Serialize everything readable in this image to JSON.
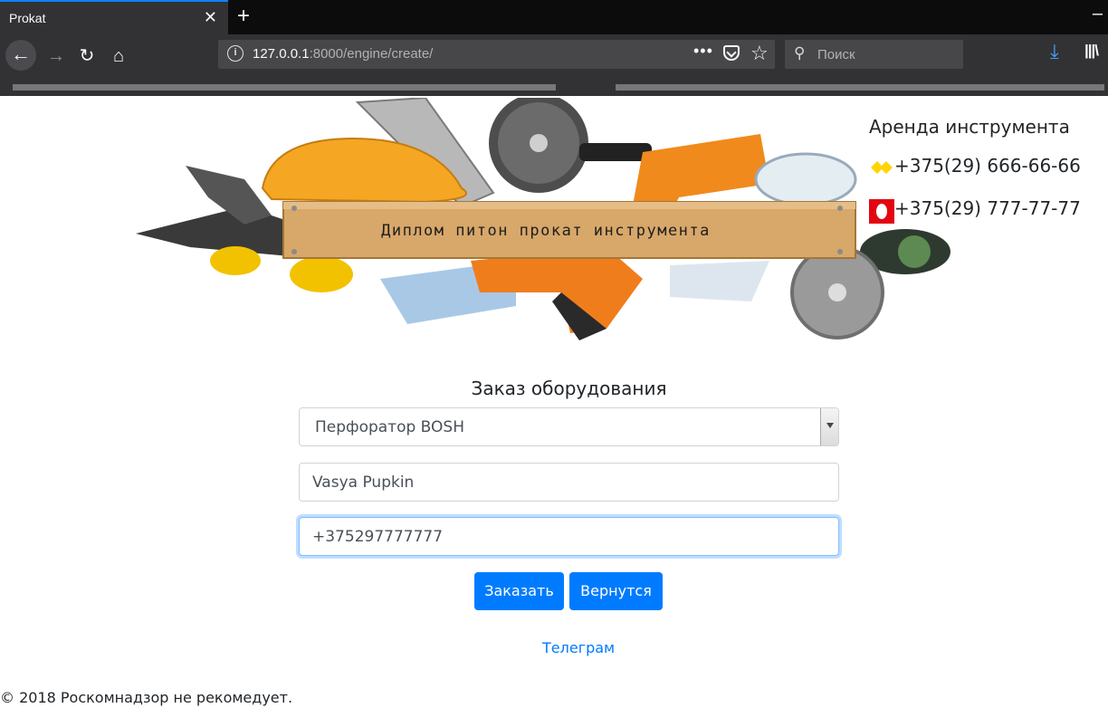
{
  "browser": {
    "tab_title": "Prokat",
    "tab_close": "✕",
    "new_tab": "+",
    "url_host": "127.0.0.1",
    "url_rest": ":8000/engine/create/",
    "search_placeholder": "Поиск",
    "icons": [
      "back-arrow-icon",
      "forward-arrow-icon",
      "reload-icon",
      "home-icon",
      "info-icon",
      "more-dots-icon",
      "pocket-icon",
      "star-icon",
      "search-icon",
      "download-icon",
      "library-icon"
    ]
  },
  "hero": {
    "plank_text": "Диплом питон прокат инструмента"
  },
  "contacts": {
    "title": "Аренда инструмента",
    "phones": [
      {
        "operator_icon": "life-operator-icon",
        "number": "+375(29) 666-66-66"
      },
      {
        "operator_icon": "mts-operator-icon",
        "number": "+375(29) 777-77-77"
      }
    ]
  },
  "form": {
    "title": "Заказ оборудования",
    "equipment_selected": "Перфоратор BOSH",
    "name_value": "Vasya Pupkin",
    "phone_value": "+375297777777",
    "submit_label": "Заказать",
    "back_label": "Вернутся"
  },
  "telegram_link": "Телеграм",
  "footer_text": "© 2018 Роскомнадзор не рекомедует.",
  "colors": {
    "primary": "#007bff",
    "focus_border": "#80bdff",
    "chrome_dark": "#323234",
    "mts_red": "#e30611",
    "life_yellow": "#ffd400"
  }
}
